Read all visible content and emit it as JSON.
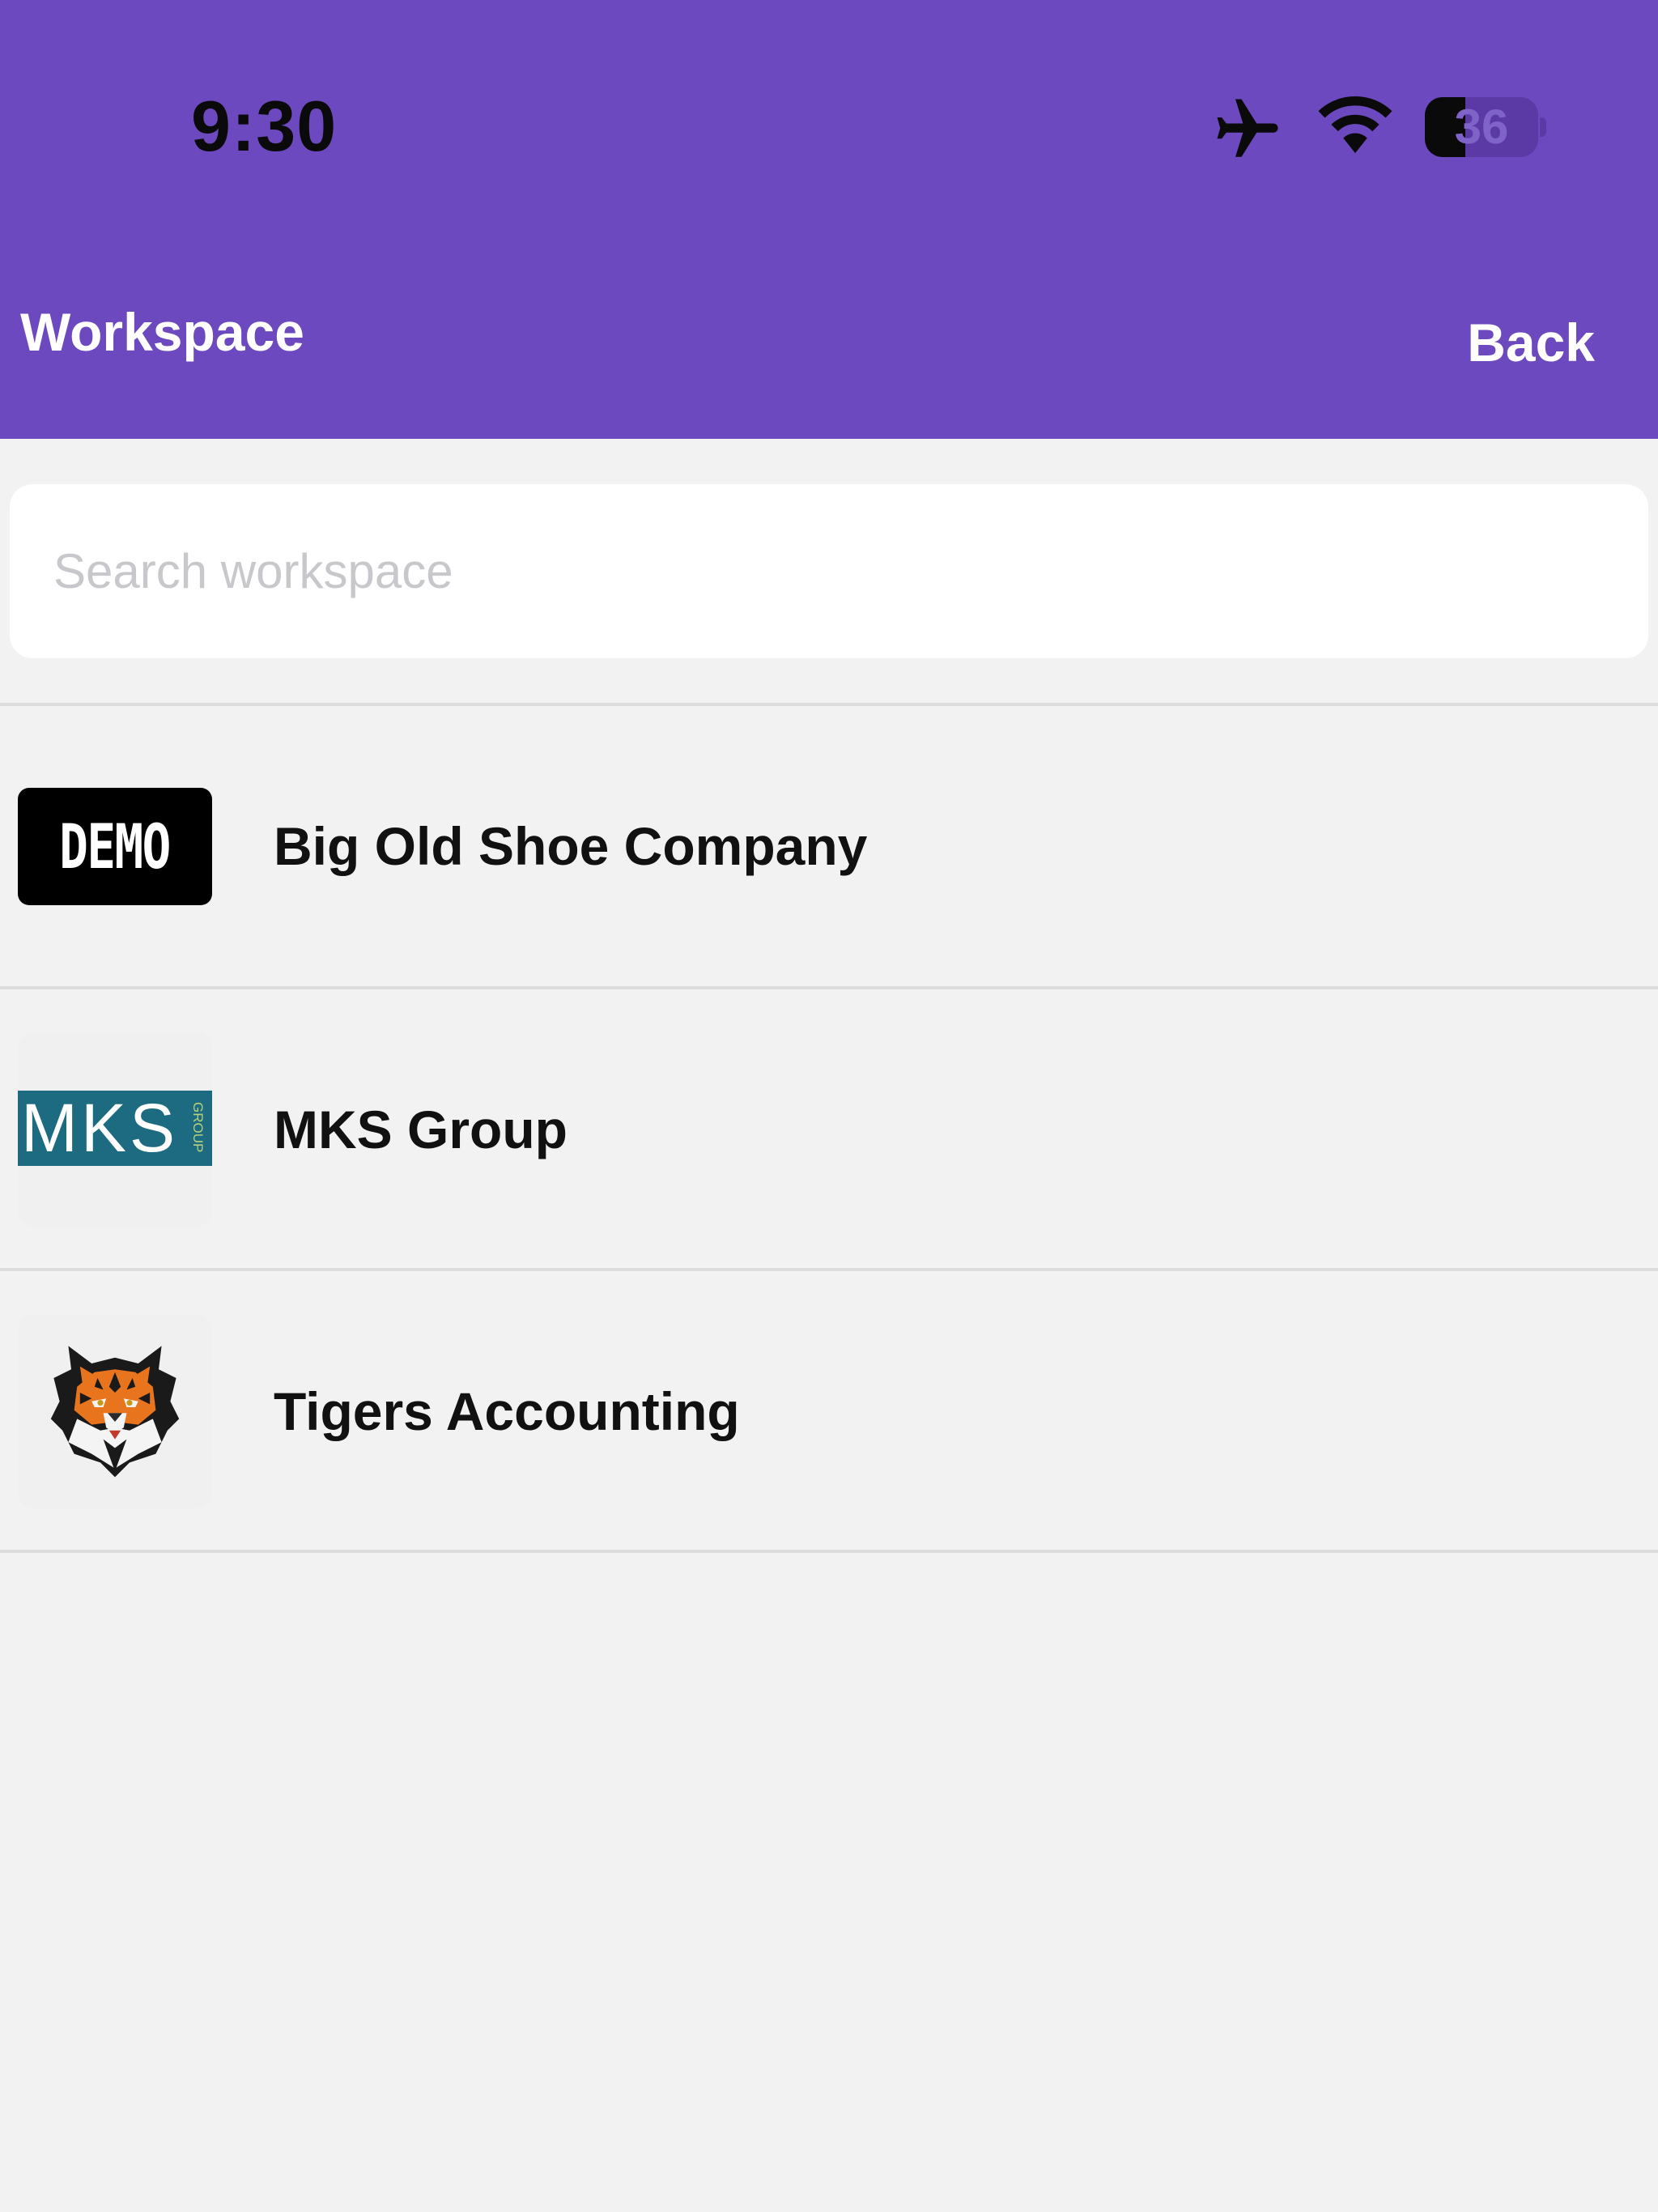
{
  "status_bar": {
    "time": "9:30",
    "battery_level": "36",
    "battery_fraction": 0.36,
    "icons": [
      "airplane-icon",
      "wifi-icon",
      "battery-icon"
    ]
  },
  "header": {
    "title": "Workspace",
    "back_label": "Back",
    "background_color": "#6d49bf"
  },
  "search": {
    "placeholder": "Search workspace",
    "value": ""
  },
  "workspaces": [
    {
      "name": "Big Old Shoe Company",
      "logo": "DEMO"
    },
    {
      "name": "MKS Group",
      "logo": "MKS",
      "logo_sub": "GROUP"
    },
    {
      "name": "Tigers Accounting",
      "logo": "tiger-head-icon"
    }
  ]
}
